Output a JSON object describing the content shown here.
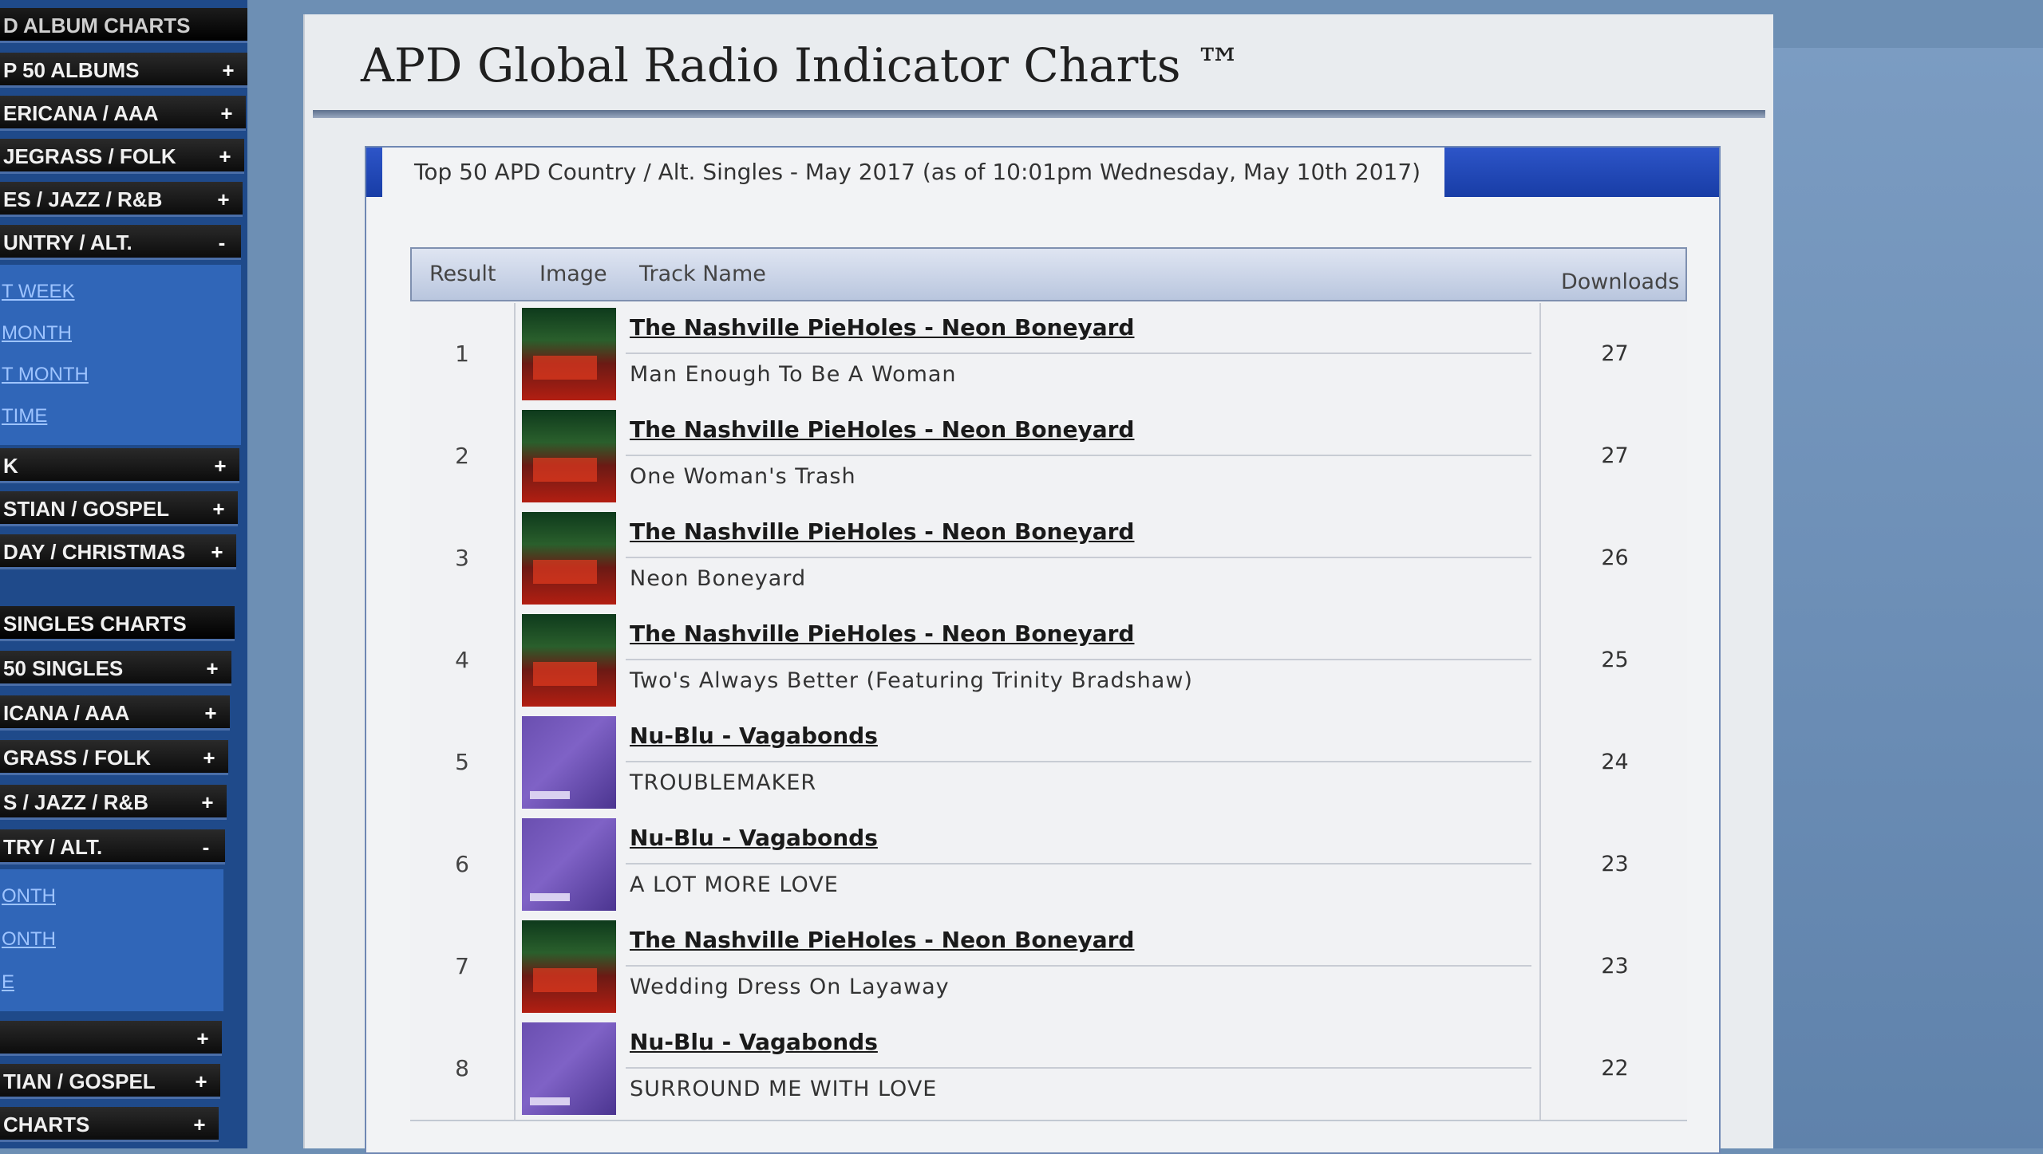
{
  "sidebar": {
    "album_header": "D ALBUM CHARTS",
    "album_items": [
      {
        "label": "P 50 ALBUMS",
        "toggle": "+"
      },
      {
        "label": "ERICANA / AAA",
        "toggle": "+"
      },
      {
        "label": "JEGRASS / FOLK",
        "toggle": "+"
      },
      {
        "label": "ES / JAZZ / R&B",
        "toggle": "+"
      },
      {
        "label": "UNTRY / ALT.",
        "toggle": "-"
      }
    ],
    "album_sub": [
      "T WEEK",
      "MONTH",
      "T MONTH",
      "TIME"
    ],
    "album_items_2": [
      {
        "label": "K",
        "toggle": "+"
      },
      {
        "label": "STIAN / GOSPEL",
        "toggle": "+"
      },
      {
        "label": "DAY / CHRISTMAS",
        "toggle": "+"
      }
    ],
    "singles_header": "SINGLES CHARTS",
    "singles_items": [
      {
        "label": "50 SINGLES",
        "toggle": "+"
      },
      {
        "label": "ICANA / AAA",
        "toggle": "+"
      },
      {
        "label": "GRASS / FOLK",
        "toggle": "+"
      },
      {
        "label": "S / JAZZ / R&B",
        "toggle": "+"
      },
      {
        "label": "TRY / ALT.",
        "toggle": "-"
      }
    ],
    "singles_sub": [
      "ONTH",
      "ONTH",
      "E"
    ],
    "singles_items_2": [
      {
        "label": "",
        "toggle": "+"
      },
      {
        "label": "TIAN / GOSPEL",
        "toggle": "+"
      },
      {
        "label": "CHARTS",
        "toggle": "+"
      }
    ]
  },
  "page": {
    "title": "APD Global Radio Indicator Charts ™"
  },
  "chart": {
    "heading": "Top 50 APD Country / Alt. Singles - May 2017 (as of 10:01pm Wednesday, May 10th 2017)",
    "columns": {
      "result": "Result",
      "image": "Image",
      "track_name": "Track Name",
      "downloads": "Downloads"
    },
    "rows": [
      {
        "rank": "1",
        "artist": "The Nashville PieHoles - Neon Boneyard",
        "track": "Man Enough To Be A Woman",
        "downloads": "27",
        "art": "nashville"
      },
      {
        "rank": "2",
        "artist": "The Nashville PieHoles - Neon Boneyard",
        "track": "One Woman's Trash",
        "downloads": "27",
        "art": "nashville"
      },
      {
        "rank": "3",
        "artist": "The Nashville PieHoles - Neon Boneyard",
        "track": "Neon Boneyard",
        "downloads": "26",
        "art": "nashville"
      },
      {
        "rank": "4",
        "artist": "The Nashville PieHoles - Neon Boneyard",
        "track": "Two's Always Better (Featuring Trinity Bradshaw)",
        "downloads": "25",
        "art": "nashville"
      },
      {
        "rank": "5",
        "artist": "Nu-Blu - Vagabonds",
        "track": "TROUBLEMAKER",
        "downloads": "24",
        "art": "nublu"
      },
      {
        "rank": "6",
        "artist": "Nu-Blu - Vagabonds",
        "track": "A LOT MORE LOVE",
        "downloads": "23",
        "art": "nublu"
      },
      {
        "rank": "7",
        "artist": "The Nashville PieHoles - Neon Boneyard",
        "track": "Wedding Dress On Layaway",
        "downloads": "23",
        "art": "nashville"
      },
      {
        "rank": "8",
        "artist": "Nu-Blu - Vagabonds",
        "track": "SURROUND ME WITH LOVE",
        "downloads": "22",
        "art": "nublu"
      }
    ]
  }
}
